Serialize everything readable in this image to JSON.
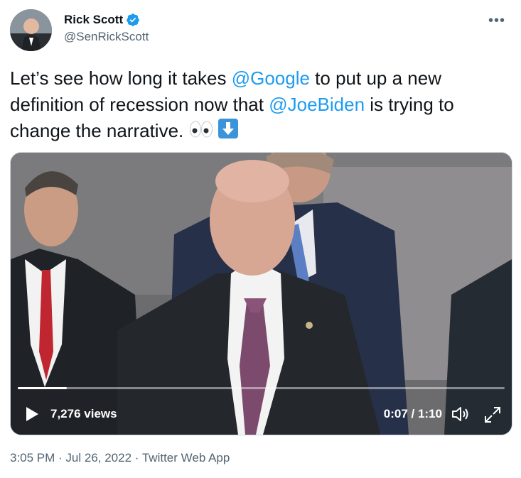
{
  "author": {
    "display_name": "Rick Scott",
    "handle": "@SenRickScott",
    "verified": true,
    "avatar_icon": "avatar-photo"
  },
  "more_icon": "ellipsis-icon",
  "tweet": {
    "text_part1": "Let’s see how long it takes ",
    "mention1": "@Google",
    "text_part2": " to put up a new definition of recession now that ",
    "mention2": "@JoeBiden",
    "text_part3": " is trying to change the narrative. "
  },
  "video": {
    "views": "7,276 views",
    "time": "0:07 / 1:10",
    "progress": 0.1,
    "controls": [
      "play-icon",
      "volume-icon",
      "fullscreen-icon"
    ]
  },
  "meta": {
    "text": "3:05 PM · Jul 26, 2022 · Twitter Web App"
  },
  "colors": {
    "mention": "#1d9bf0",
    "verified": "#1d9bf0",
    "secondary_text": "#536471"
  }
}
